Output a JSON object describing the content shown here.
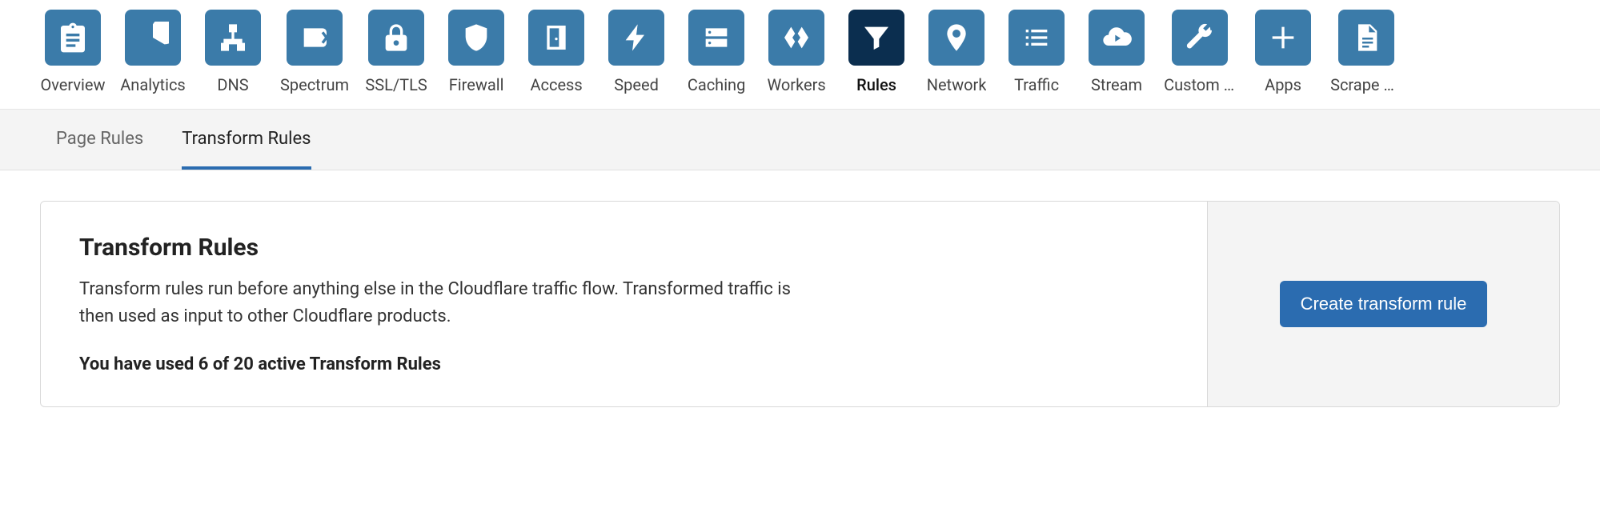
{
  "nav": [
    {
      "label": "Overview",
      "icon": "clipboard"
    },
    {
      "label": "Analytics",
      "icon": "pie"
    },
    {
      "label": "DNS",
      "icon": "sitemap"
    },
    {
      "label": "Spectrum",
      "icon": "spectrum"
    },
    {
      "label": "SSL/TLS",
      "icon": "lock"
    },
    {
      "label": "Firewall",
      "icon": "shield"
    },
    {
      "label": "Access",
      "icon": "door"
    },
    {
      "label": "Speed",
      "icon": "bolt"
    },
    {
      "label": "Caching",
      "icon": "drive"
    },
    {
      "label": "Workers",
      "icon": "workers"
    },
    {
      "label": "Rules",
      "icon": "funnel",
      "active": true
    },
    {
      "label": "Network",
      "icon": "pin"
    },
    {
      "label": "Traffic",
      "icon": "list"
    },
    {
      "label": "Stream",
      "icon": "cloud-play"
    },
    {
      "label": "Custom P…",
      "icon": "wrench"
    },
    {
      "label": "Apps",
      "icon": "plus"
    },
    {
      "label": "Scrape S…",
      "icon": "file"
    }
  ],
  "subtabs": [
    {
      "label": "Page Rules",
      "active": false
    },
    {
      "label": "Transform Rules",
      "active": true
    }
  ],
  "panel": {
    "title": "Transform Rules",
    "description": "Transform rules run before anything else in the Cloudflare traffic flow. Transformed traffic is then used as input to other Cloudflare products.",
    "usage": "You have used 6 of 20 active Transform Rules",
    "create_button": "Create transform rule"
  }
}
